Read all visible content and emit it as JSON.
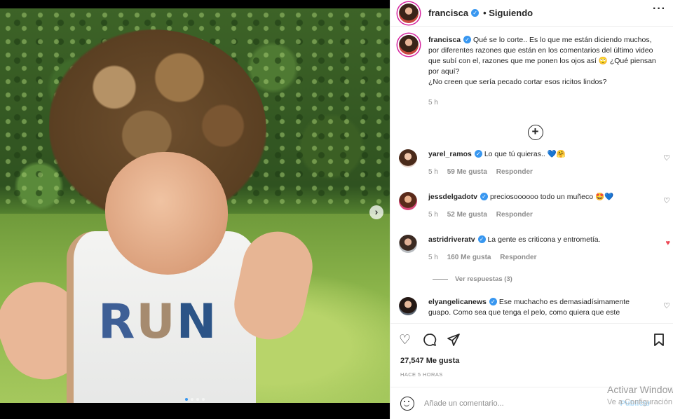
{
  "post": {
    "username": "francisca",
    "follow_status": "Siguiendo",
    "more_icon": "more-horizontal-icon",
    "caption_line1": "Qué se lo corte.. Es lo que me están diciendo muchos, por diferentes razones que están en los comentarios del último video que subí con el, razones que me ponen los ojos así 🙄 ¿Qué piensan por aquí?",
    "caption_line2": "¿No creen que sería pecado cortar esos ricitos lindos?",
    "caption_time": "5 h",
    "load_more_icon": "plus-circle-icon",
    "likes": "27,547 Me gusta",
    "posted_ago": "HACE 5 HORAS",
    "image_text": "RUN"
  },
  "comments": [
    {
      "username": "yarel_ramos",
      "text": "Lo que tú quieras.. 💙🤗",
      "time": "5 h",
      "likes": "59 Me gusta",
      "reply": "Responder",
      "liked": false
    },
    {
      "username": "jessdelgadotv",
      "text": "preciosoooooo todo un muñeco 🤩💙",
      "time": "5 h",
      "likes": "52 Me gusta",
      "reply": "Responder",
      "liked": false
    },
    {
      "username": "astridriveratv",
      "text": "La gente es criticona y entrometía.",
      "time": "5 h",
      "likes": "160 Me gusta",
      "reply": "Responder",
      "liked": true
    },
    {
      "username": "elyangelicanews",
      "text": "Ese muchacho es demasiadísimamente guapo. Como sea que tenga el pelo, como quiera que este"
    }
  ],
  "view_replies": "Ver respuestas (3)",
  "actions": {
    "like_icon": "heart-icon",
    "comment_icon": "comment-icon",
    "share_icon": "send-icon",
    "save_icon": "bookmark-icon"
  },
  "add_comment": {
    "placeholder": "Añade un comentario...",
    "publish_label": "Publicar",
    "emoji_icon": "smiley-icon"
  },
  "watermark": {
    "line1": "Activar Windows",
    "line2": "Ve a Configuración"
  },
  "colors": {
    "verified": "#3897f0",
    "liked_heart": "#ed4956",
    "story_ring": "#d6249f"
  }
}
